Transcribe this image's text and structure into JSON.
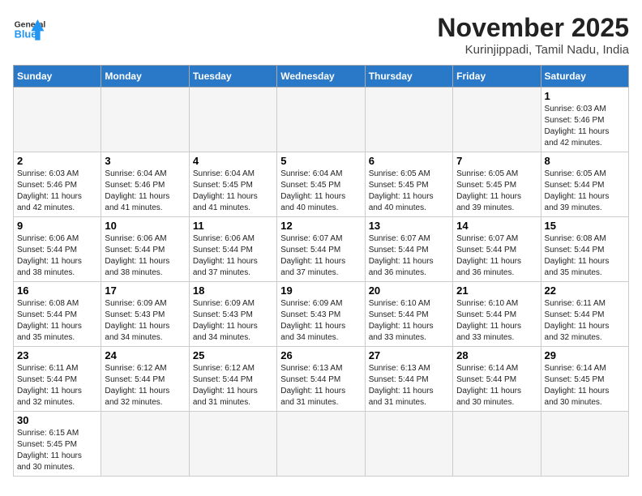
{
  "header": {
    "logo_general": "General",
    "logo_blue": "Blue",
    "month_title": "November 2025",
    "location": "Kurinjippadi, Tamil Nadu, India"
  },
  "weekdays": [
    "Sunday",
    "Monday",
    "Tuesday",
    "Wednesday",
    "Thursday",
    "Friday",
    "Saturday"
  ],
  "weeks": [
    [
      {
        "day": "",
        "info": ""
      },
      {
        "day": "",
        "info": ""
      },
      {
        "day": "",
        "info": ""
      },
      {
        "day": "",
        "info": ""
      },
      {
        "day": "",
        "info": ""
      },
      {
        "day": "",
        "info": ""
      },
      {
        "day": "1",
        "info": "Sunrise: 6:03 AM\nSunset: 5:46 PM\nDaylight: 11 hours\nand 42 minutes."
      }
    ],
    [
      {
        "day": "2",
        "info": "Sunrise: 6:03 AM\nSunset: 5:46 PM\nDaylight: 11 hours\nand 42 minutes."
      },
      {
        "day": "3",
        "info": "Sunrise: 6:04 AM\nSunset: 5:46 PM\nDaylight: 11 hours\nand 41 minutes."
      },
      {
        "day": "4",
        "info": "Sunrise: 6:04 AM\nSunset: 5:45 PM\nDaylight: 11 hours\nand 41 minutes."
      },
      {
        "day": "5",
        "info": "Sunrise: 6:04 AM\nSunset: 5:45 PM\nDaylight: 11 hours\nand 40 minutes."
      },
      {
        "day": "6",
        "info": "Sunrise: 6:05 AM\nSunset: 5:45 PM\nDaylight: 11 hours\nand 40 minutes."
      },
      {
        "day": "7",
        "info": "Sunrise: 6:05 AM\nSunset: 5:45 PM\nDaylight: 11 hours\nand 39 minutes."
      },
      {
        "day": "8",
        "info": "Sunrise: 6:05 AM\nSunset: 5:44 PM\nDaylight: 11 hours\nand 39 minutes."
      }
    ],
    [
      {
        "day": "9",
        "info": "Sunrise: 6:06 AM\nSunset: 5:44 PM\nDaylight: 11 hours\nand 38 minutes."
      },
      {
        "day": "10",
        "info": "Sunrise: 6:06 AM\nSunset: 5:44 PM\nDaylight: 11 hours\nand 38 minutes."
      },
      {
        "day": "11",
        "info": "Sunrise: 6:06 AM\nSunset: 5:44 PM\nDaylight: 11 hours\nand 37 minutes."
      },
      {
        "day": "12",
        "info": "Sunrise: 6:07 AM\nSunset: 5:44 PM\nDaylight: 11 hours\nand 37 minutes."
      },
      {
        "day": "13",
        "info": "Sunrise: 6:07 AM\nSunset: 5:44 PM\nDaylight: 11 hours\nand 36 minutes."
      },
      {
        "day": "14",
        "info": "Sunrise: 6:07 AM\nSunset: 5:44 PM\nDaylight: 11 hours\nand 36 minutes."
      },
      {
        "day": "15",
        "info": "Sunrise: 6:08 AM\nSunset: 5:44 PM\nDaylight: 11 hours\nand 35 minutes."
      }
    ],
    [
      {
        "day": "16",
        "info": "Sunrise: 6:08 AM\nSunset: 5:44 PM\nDaylight: 11 hours\nand 35 minutes."
      },
      {
        "day": "17",
        "info": "Sunrise: 6:09 AM\nSunset: 5:43 PM\nDaylight: 11 hours\nand 34 minutes."
      },
      {
        "day": "18",
        "info": "Sunrise: 6:09 AM\nSunset: 5:43 PM\nDaylight: 11 hours\nand 34 minutes."
      },
      {
        "day": "19",
        "info": "Sunrise: 6:09 AM\nSunset: 5:43 PM\nDaylight: 11 hours\nand 34 minutes."
      },
      {
        "day": "20",
        "info": "Sunrise: 6:10 AM\nSunset: 5:44 PM\nDaylight: 11 hours\nand 33 minutes."
      },
      {
        "day": "21",
        "info": "Sunrise: 6:10 AM\nSunset: 5:44 PM\nDaylight: 11 hours\nand 33 minutes."
      },
      {
        "day": "22",
        "info": "Sunrise: 6:11 AM\nSunset: 5:44 PM\nDaylight: 11 hours\nand 32 minutes."
      }
    ],
    [
      {
        "day": "23",
        "info": "Sunrise: 6:11 AM\nSunset: 5:44 PM\nDaylight: 11 hours\nand 32 minutes."
      },
      {
        "day": "24",
        "info": "Sunrise: 6:12 AM\nSunset: 5:44 PM\nDaylight: 11 hours\nand 32 minutes."
      },
      {
        "day": "25",
        "info": "Sunrise: 6:12 AM\nSunset: 5:44 PM\nDaylight: 11 hours\nand 31 minutes."
      },
      {
        "day": "26",
        "info": "Sunrise: 6:13 AM\nSunset: 5:44 PM\nDaylight: 11 hours\nand 31 minutes."
      },
      {
        "day": "27",
        "info": "Sunrise: 6:13 AM\nSunset: 5:44 PM\nDaylight: 11 hours\nand 31 minutes."
      },
      {
        "day": "28",
        "info": "Sunrise: 6:14 AM\nSunset: 5:44 PM\nDaylight: 11 hours\nand 30 minutes."
      },
      {
        "day": "29",
        "info": "Sunrise: 6:14 AM\nSunset: 5:45 PM\nDaylight: 11 hours\nand 30 minutes."
      }
    ],
    [
      {
        "day": "30",
        "info": "Sunrise: 6:15 AM\nSunset: 5:45 PM\nDaylight: 11 hours\nand 30 minutes."
      },
      {
        "day": "",
        "info": ""
      },
      {
        "day": "",
        "info": ""
      },
      {
        "day": "",
        "info": ""
      },
      {
        "day": "",
        "info": ""
      },
      {
        "day": "",
        "info": ""
      },
      {
        "day": "",
        "info": ""
      }
    ]
  ]
}
